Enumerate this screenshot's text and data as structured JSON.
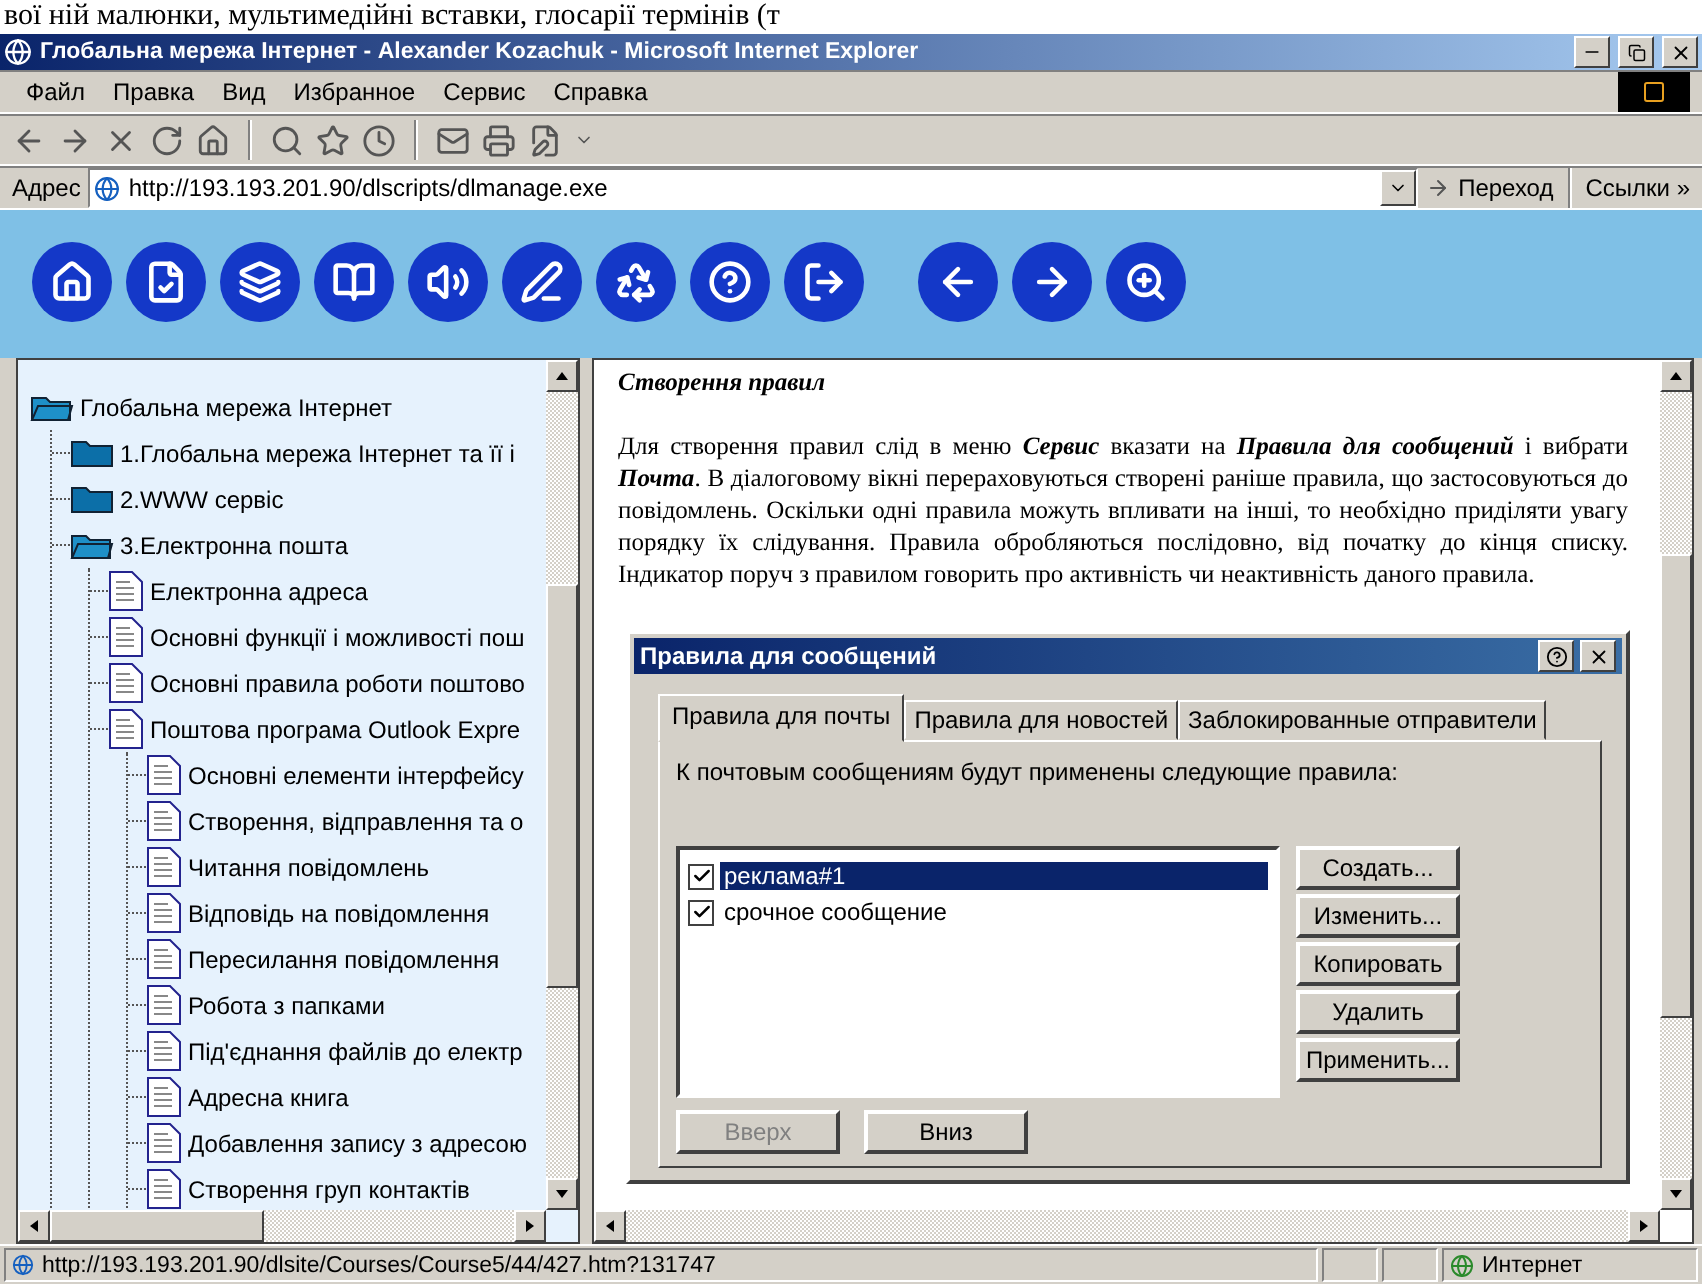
{
  "document_fragment": "вої ній малюнки, мультимедійні вставки, глосарії термінів (т",
  "window": {
    "title": "Глобальна мережа Інтернет - Alexander Kozachuk - Microsoft Internet Explorer"
  },
  "menu": [
    "Файл",
    "Правка",
    "Вид",
    "Избранное",
    "Сервис",
    "Справка"
  ],
  "address_bar": {
    "label": "Адрес",
    "value": "http://193.193.201.90/dlscripts/dlmanage.exe",
    "go": "Переход",
    "links": "Ссылки »"
  },
  "tree": {
    "label": "Глобальна мережа Інтернет",
    "kind": "folder",
    "expanded": true,
    "children": [
      {
        "label": "1.Глобальна мережа Інтернет та її і",
        "kind": "folder",
        "expanded": false
      },
      {
        "label": "2.WWW сервіс",
        "kind": "folder",
        "expanded": false
      },
      {
        "label": "3.Електронна пошта",
        "kind": "folder",
        "expanded": true,
        "children": [
          {
            "label": "Електронна адреса",
            "kind": "document"
          },
          {
            "label": "Основні функції і можливості пош",
            "kind": "document"
          },
          {
            "label": "Основні правила роботи поштово",
            "kind": "document"
          },
          {
            "label": "Поштова програма Outlook Expre",
            "kind": "document",
            "children": [
              {
                "label": "Основні елементи інтерфейсу",
                "kind": "document"
              },
              {
                "label": "Створення, відправлення та о",
                "kind": "document"
              },
              {
                "label": "Читання повідомлень",
                "kind": "document"
              },
              {
                "label": "Відповідь на повідомлення",
                "kind": "document"
              },
              {
                "label": "Пересилання повідомлення",
                "kind": "document"
              },
              {
                "label": "Робота з папками",
                "kind": "document"
              },
              {
                "label": "Під'єднання файлів до електр",
                "kind": "document"
              },
              {
                "label": "Адресна книга",
                "kind": "document"
              },
              {
                "label": "Добавлення запису з адресою",
                "kind": "document"
              },
              {
                "label": "Створення груп контактів",
                "kind": "document"
              }
            ]
          }
        ]
      }
    ]
  },
  "article": {
    "heading": "Створення правил",
    "paragraph": "Для створення правил слід в меню **Сервис** вказати на **Правила для сообщений** і вибрати **Почта**. В діалоговому вікні перераховуються створені раніше правила, що застосовуються до повідомлень. Оскільки одні правила можуть впливати на інші, то необхідно приділяти увагу порядку їх слідування. Правила обробляються послідовно, від початку до кінця списку. Індикатор поруч з правилом говорить про активність чи неактивність даного правила."
  },
  "dialog": {
    "title": "Правила для сообщений",
    "tabs": [
      {
        "label": "Правила для почты",
        "selected": true
      },
      {
        "label": "Правила для новостей",
        "selected": false
      },
      {
        "label": "Заблокированные отправители",
        "selected": false
      }
    ],
    "caption": "К почтовым сообщениям будут применены следующие правила:",
    "rules": [
      {
        "label": "реклама#1",
        "checked": true,
        "selected": true
      },
      {
        "label": "срочное сообщение",
        "checked": true,
        "selected": false
      }
    ],
    "buttons": [
      "Создать...",
      "Изменить...",
      "Копировать",
      "Удалить",
      "Применить..."
    ],
    "order_buttons": [
      {
        "label": "Вверх",
        "disabled": true
      },
      {
        "label": "Вниз",
        "disabled": false
      }
    ]
  },
  "status_bar": {
    "url": "http://193.193.201.90/dlsite/Courses/Course5/44/427.htm?131747",
    "zone": "Интернет"
  }
}
